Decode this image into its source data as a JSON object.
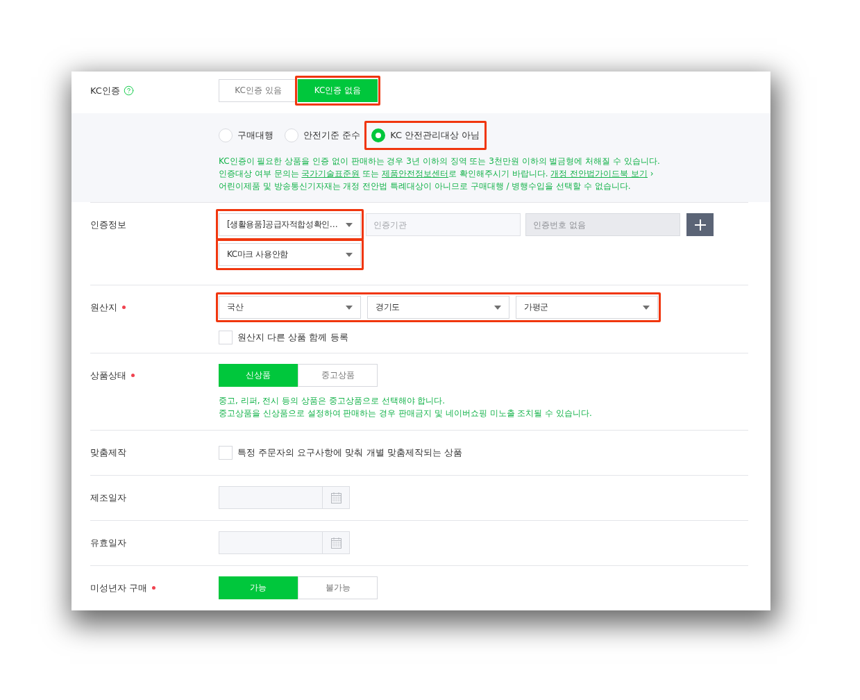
{
  "rows": [
    {
      "kind": "toggle",
      "label": "KC인증",
      "help": true,
      "options": [
        {
          "label": "KC인증 있음",
          "selected": false,
          "highlighted": false
        },
        {
          "label": "KC인증 없음",
          "selected": true,
          "highlighted": true
        }
      ],
      "panel": {
        "radios": [
          {
            "label": "구매대행",
            "selected": false,
            "highlighted": false
          },
          {
            "label": "안전기준 준수",
            "selected": false,
            "highlighted": false
          },
          {
            "label": "KC 안전관리대상 아님",
            "selected": true,
            "highlighted": true
          }
        ],
        "notes": [
          [
            {
              "kind": "text",
              "text": "KC인증이 필요한 상품을 인증 없이 판매하는 경우 3년 이하의 징역 또는 3천만원 이하의 벌금형에 처해질 수 있습니다."
            }
          ],
          [
            {
              "kind": "text",
              "text": "인증대상 여부 문의는 "
            },
            {
              "kind": "link",
              "text": "국가기술표준원"
            },
            {
              "kind": "text",
              "text": " 또는 "
            },
            {
              "kind": "link",
              "text": "제품안전정보센터"
            },
            {
              "kind": "text",
              "text": "로 확인해주시기 바랍니다. "
            },
            {
              "kind": "link",
              "text": "개정 전안법가이드북 보기"
            },
            {
              "kind": "text",
              "text": " ›"
            }
          ],
          [
            {
              "kind": "text",
              "text": "어린이제품 및 방송통신기자재는 개정 전안법 특례대상이 아니므로 구매대행 / 병행수입을 선택할 수 없습니다."
            }
          ]
        ]
      }
    },
    {
      "kind": "certification",
      "label": "인증정보",
      "type_select": {
        "value": "[생활용품]공급자적합성확인…",
        "highlighted": true
      },
      "inputs": [
        {
          "placeholder": "인증기관",
          "disabled": false
        },
        {
          "placeholder": "인증번호 없음",
          "disabled": true
        }
      ],
      "mark_select": {
        "value": "KC마크 사용안함",
        "highlighted": true
      }
    },
    {
      "kind": "origin",
      "label": "원산지",
      "required": true,
      "highlighted": true,
      "selects": [
        {
          "value": "국산"
        },
        {
          "value": "경기도"
        },
        {
          "value": "가평군"
        }
      ],
      "checkbox": {
        "label": "원산지 다른 상품 함께 등록",
        "checked": false
      }
    },
    {
      "kind": "toggle",
      "label": "상품상태",
      "required": true,
      "options": [
        {
          "label": "신상품",
          "selected": true
        },
        {
          "label": "중고상품",
          "selected": false
        }
      ],
      "notes": [
        [
          {
            "kind": "text",
            "text": "중고, 리퍼, 전시 등의 상품은 중고상품으로 선택해야 합니다."
          }
        ],
        [
          {
            "kind": "text",
            "text": "중고상품을 신상품으로 설정하여 판매하는 경우 판매금지 및 네이버쇼핑 미노출 조치될 수 있습니다."
          }
        ]
      ]
    },
    {
      "kind": "checkbox",
      "label": "맞춤제작",
      "checkbox": {
        "label": "특정 주문자의 요구사항에 맞춰 개별 맞춤제작되는 상품",
        "checked": false
      }
    },
    {
      "kind": "date",
      "label": "제조일자"
    },
    {
      "kind": "date",
      "label": "유효일자"
    },
    {
      "kind": "toggle",
      "label": "미성년자 구매",
      "required": true,
      "options": [
        {
          "label": "가능",
          "selected": true
        },
        {
          "label": "불가능",
          "selected": false
        }
      ]
    }
  ]
}
